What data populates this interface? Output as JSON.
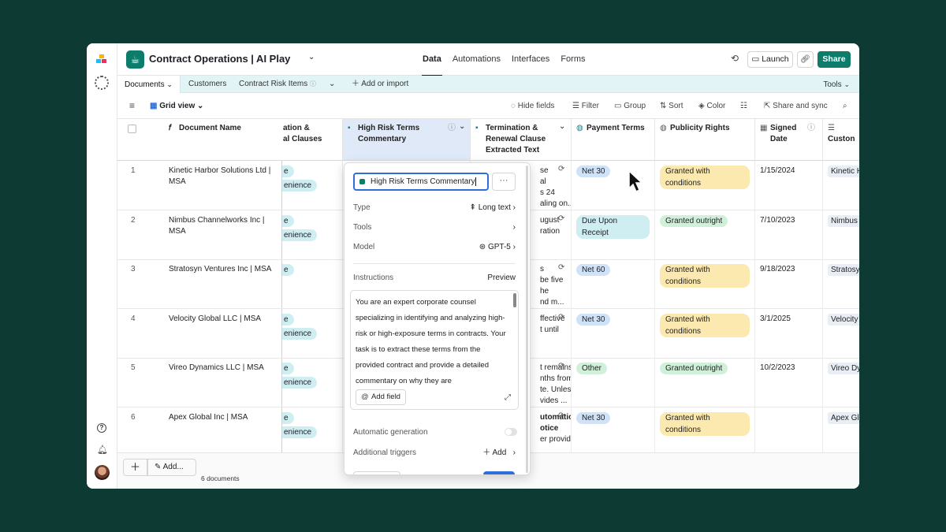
{
  "app": {
    "base_title": "Contract Operations | AI Play",
    "nav_tabs": [
      "Data",
      "Automations",
      "Interfaces",
      "Forms"
    ],
    "launch_label": "Launch",
    "share_label": "Share"
  },
  "tables": {
    "items": [
      "Documents",
      "Customers",
      "Contract Risk Items"
    ],
    "add_label": "Add or import",
    "tools_label": "Tools"
  },
  "view": {
    "name": "Grid view",
    "actions": [
      "Hide fields",
      "Filter",
      "Group",
      "Sort",
      "Color",
      "Share and sync"
    ]
  },
  "columns": {
    "document_name": "Document Name",
    "termination_partial": "ation &",
    "termination_partial2": "al Clauses",
    "high_risk": "High Risk Terms",
    "high_risk2": "Commentary",
    "term_renewal": "Termination &",
    "term_renewal2": "Renewal Clause",
    "term_renewal3": "Extracted Text",
    "payment_terms": "Payment Terms",
    "publicity_rights": "Publicity Rights",
    "signed_date": "Signed",
    "signed_date2": "Date",
    "customer": "Custon"
  },
  "rows": [
    {
      "num": "1",
      "doc": "Kinetic Harbor Solutions Ltd | MSA",
      "pill_partial": "e",
      "pill_partial2": "enience",
      "extract": [
        "se",
        "al",
        "s 24",
        "aling on..."
      ],
      "payment": "Net 30",
      "publicity": "Granted with conditions",
      "signed": "1/15/2024",
      "customer": "Kinetic H"
    },
    {
      "num": "2",
      "doc": "Nimbus Channelworks Inc | MSA",
      "pill_partial": "e",
      "pill_partial2": "enience",
      "extract": [
        "",
        "ugust",
        "ration",
        ""
      ],
      "payment": "Due Upon Receipt",
      "publicity": "Granted outright",
      "signed": "7/10/2023",
      "customer": "Nimbus C"
    },
    {
      "num": "3",
      "doc": "Stratosyn Ventures Inc | MSA",
      "pill_partial": "e",
      "pill_partial2": "",
      "extract": [
        "s",
        "be five",
        "he",
        "nd m..."
      ],
      "payment": "Net 60",
      "publicity": "Granted with conditions",
      "signed": "9/18/2023",
      "customer": "Stratosyn"
    },
    {
      "num": "4",
      "doc": "Velocity Global LLC | MSA",
      "pill_partial": "e",
      "pill_partial2": "enience",
      "extract": [
        "",
        "ffective",
        "t until",
        ""
      ],
      "payment": "Net 30",
      "publicity": "Granted with conditions",
      "signed": "3/1/2025",
      "customer": "Velocity G"
    },
    {
      "num": "5",
      "doc": "Vireo Dynamics LLC | MSA",
      "pill_partial": "e",
      "pill_partial2": "enience",
      "extract": [
        "t remains in",
        "nths from",
        "te. Unless",
        "vides ..."
      ],
      "payment": "Other",
      "publicity": "Granted outright",
      "signed": "10/2/2023",
      "customer": "Vireo Dyn"
    },
    {
      "num": "6",
      "doc": "Apex Global Inc | MSA",
      "pill_partial": "e",
      "pill_partial2": "enience",
      "extract": [
        "utomatic",
        "otice",
        "",
        "er provid..."
      ],
      "payment": "Net 30",
      "publicity": "Granted with conditions",
      "signed": "",
      "customer": "Apex Glo"
    }
  ],
  "footer": {
    "add_label": "Add...",
    "count": "6 documents"
  },
  "popup": {
    "field_name": "High Risk Terms Commentary",
    "type_label": "Type",
    "type_value": "Long text",
    "tools_label": "Tools",
    "model_label": "Model",
    "model_value": "GPT-5",
    "instructions_label": "Instructions",
    "preview_label": "Preview",
    "instructions_text": "You are an expert corporate counsel specializing in identifying and analyzing high-risk or high-exposure terms in contracts. Your task is to extract these terms from the provided contract and provide a detailed commentary on why they are",
    "add_field_label": "Add field",
    "auto_gen_label": "Automatic generation",
    "triggers_label": "Additional triggers",
    "add_label": "Add"
  },
  "colors": {
    "background": "#0d3a33",
    "brand": "#0e7c6b",
    "tablebar": "#e3f4f6",
    "selected_header": "#dfe9f7",
    "focus": "#2f6fdb"
  }
}
